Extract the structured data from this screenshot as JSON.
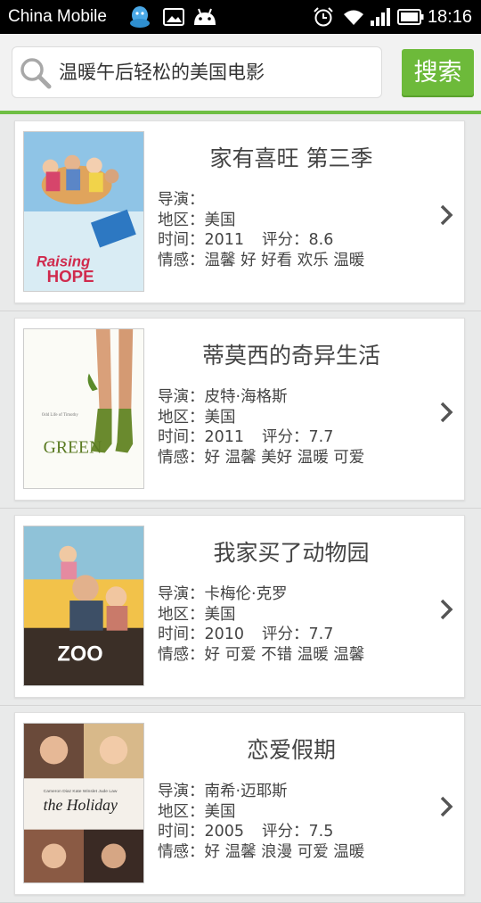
{
  "status_bar": {
    "carrier": "China Mobile",
    "time": "18:16",
    "icons": [
      "qq-icon",
      "image-icon",
      "android-icon",
      "alarm-icon",
      "wifi-icon",
      "signal-icon",
      "battery-icon"
    ]
  },
  "search": {
    "query": "温暖午后轻松的美国电影",
    "button_label": "搜索"
  },
  "colors": {
    "accent": "#6dba3a",
    "accent_line": "#6fbf44",
    "background": "#e9eaea"
  },
  "movies": [
    {
      "title": "家有喜旺 第三季",
      "director_label": "导演：",
      "director": "",
      "region_label": "地区：",
      "region": "美国",
      "year_label": "时间：",
      "year": "2011",
      "rating_label": "评分：",
      "rating": "8.6",
      "tags_label": "情感：",
      "tags": "温馨 好 好看 欢乐 温暖",
      "poster_text": "Raising HOPE"
    },
    {
      "title": "蒂莫西的奇异生活",
      "director_label": "导演：",
      "director": "皮特·海格斯",
      "region_label": "地区：",
      "region": "美国",
      "year_label": "时间：",
      "year": "2011",
      "rating_label": "评分：",
      "rating": "7.7",
      "tags_label": "情感：",
      "tags": "好 温馨 美好 温暖 可爱",
      "poster_text": "GREEN"
    },
    {
      "title": "我家买了动物园",
      "director_label": "导演：",
      "director": "卡梅伦·克罗",
      "region_label": "地区：",
      "region": "美国",
      "year_label": "时间：",
      "year": "2010",
      "rating_label": "评分：",
      "rating": "7.7",
      "tags_label": "情感：",
      "tags": "好 可爱 不错 温暖 温馨",
      "poster_text": "ZOO"
    },
    {
      "title": "恋爱假期",
      "director_label": "导演：",
      "director": "南希·迈耶斯",
      "region_label": "地区：",
      "region": "美国",
      "year_label": "时间：",
      "year": "2005",
      "rating_label": "评分：",
      "rating": "7.5",
      "tags_label": "情感：",
      "tags": "好 温馨 浪漫 可爱 温暖",
      "poster_text": "the Holiday"
    }
  ]
}
